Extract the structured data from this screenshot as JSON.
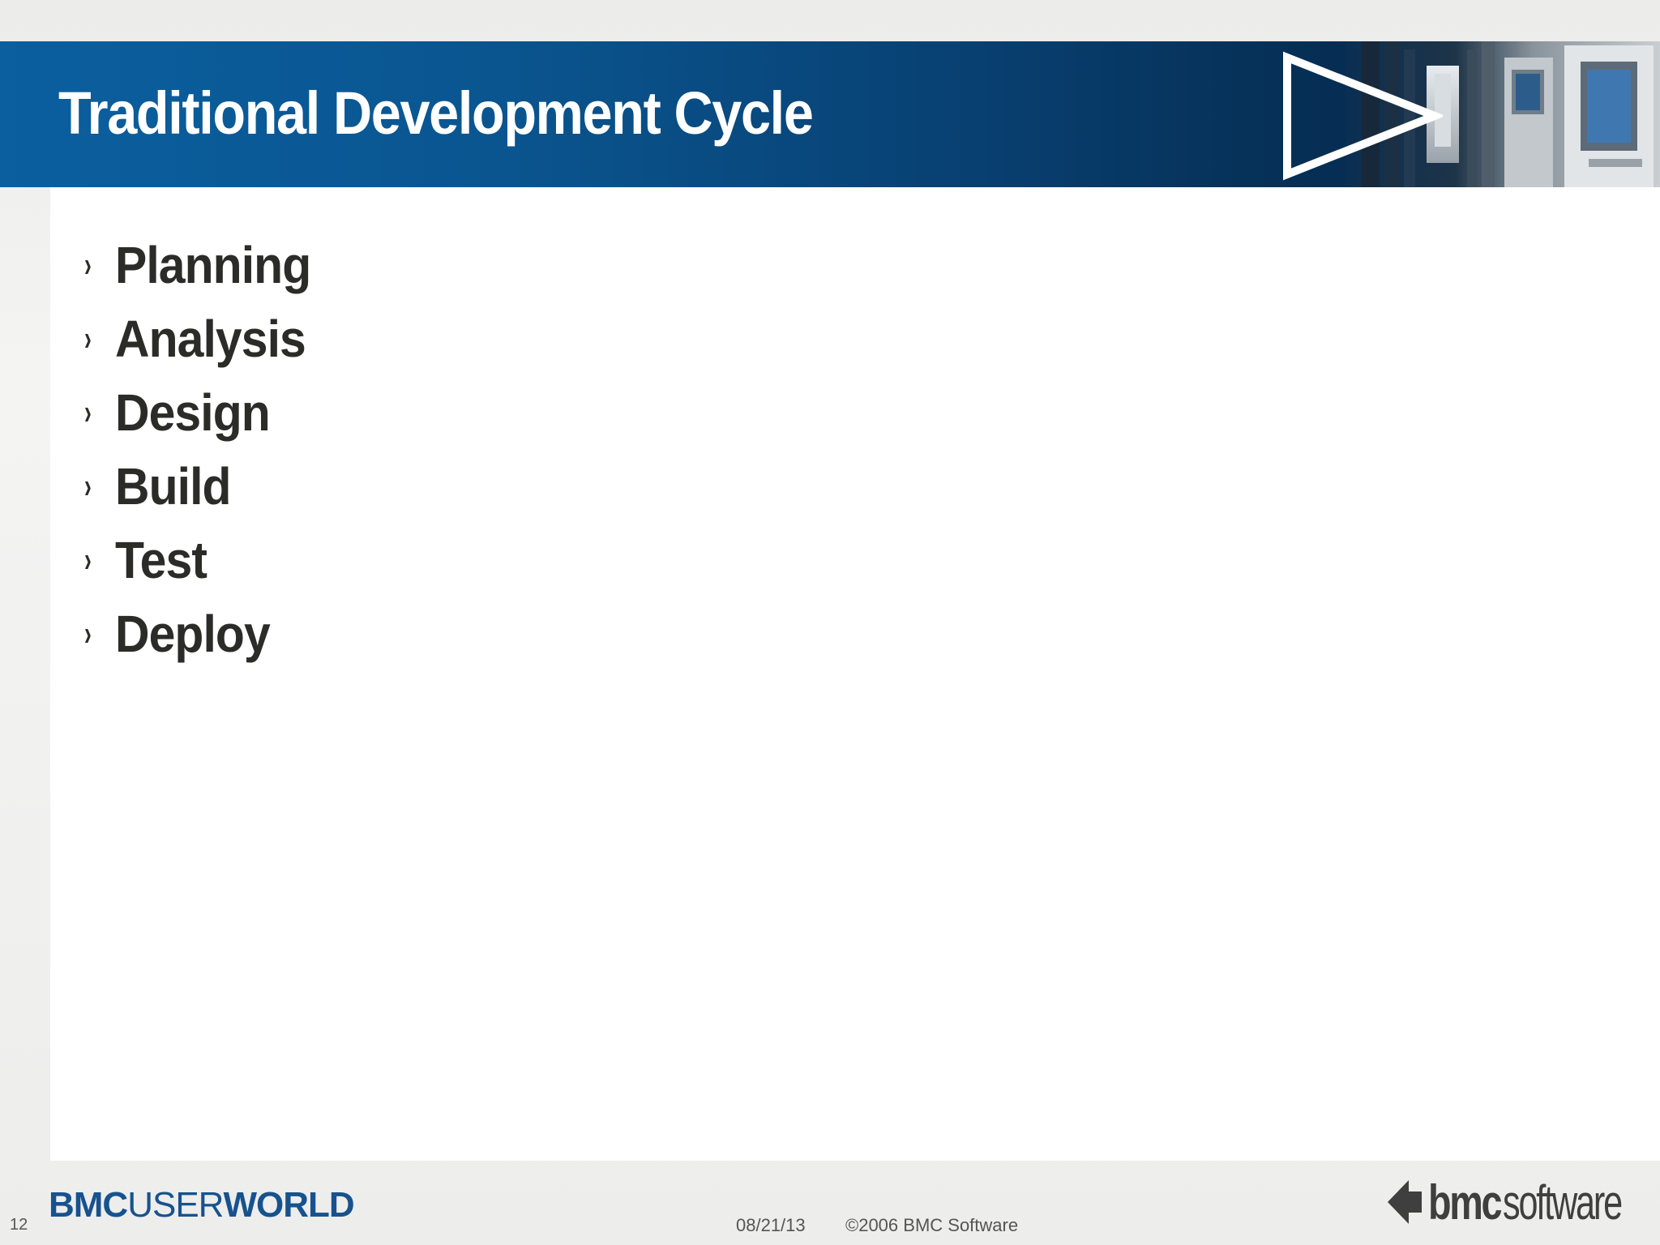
{
  "slide": {
    "title": "Traditional Development Cycle",
    "bullet_marker": "›",
    "bullets": [
      "Planning",
      "Analysis",
      "Design",
      "Build",
      "Test",
      "Deploy"
    ]
  },
  "footer": {
    "slide_number": "12",
    "event_brand_part1": "BMC",
    "event_brand_part2": "USER",
    "event_brand_part3": "WORLD",
    "date": "08/21/13",
    "copyright": "©2006 BMC Software",
    "company_brand_part1": "bmc",
    "company_brand_part2": "software"
  },
  "colors": {
    "header_blue": "#0b5f9f",
    "header_dark": "#06284a",
    "title_text": "#ffffff",
    "bullet_text": "#2b2b28",
    "brand_blue": "#17528e",
    "footer_text": "#555555"
  },
  "icons": [
    "play-triangle-icon",
    "bmc-arrow-logo-icon"
  ]
}
